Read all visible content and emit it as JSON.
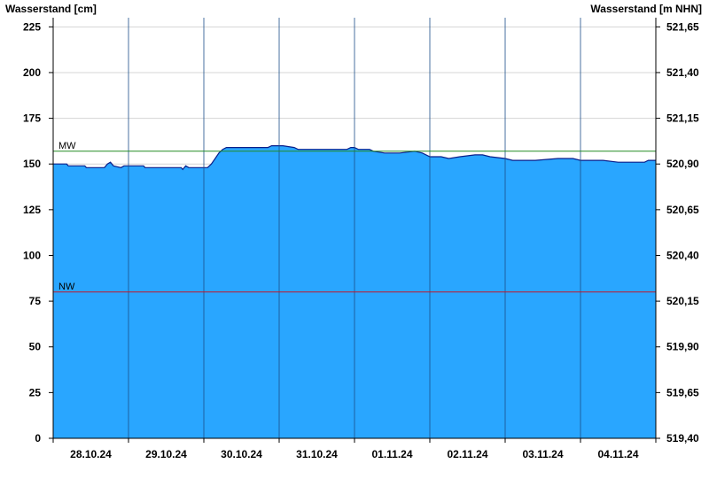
{
  "chart_data": {
    "type": "area",
    "ylabel_left": "Wasserstand [cm]",
    "ylabel_right": "Wasserstand [m NHN]",
    "ylim": [
      0,
      230
    ],
    "yticks_left": [
      0,
      25,
      50,
      75,
      100,
      125,
      150,
      175,
      200,
      225
    ],
    "yticks_right": [
      "519,40",
      "519,65",
      "519,90",
      "520,15",
      "520,40",
      "520,65",
      "520,90",
      "521,15",
      "521,40",
      "521,65"
    ],
    "xlim": [
      0,
      8
    ],
    "x_categories": [
      "28.10.24",
      "29.10.24",
      "30.10.24",
      "31.10.24",
      "01.11.24",
      "02.11.24",
      "03.11.24",
      "04.11.24"
    ],
    "grid": true,
    "colors": {
      "fill": "#29a6ff",
      "line": "#0a1f8a",
      "mw": "#228b22",
      "nw": "#c0182a"
    },
    "reference_lines": [
      {
        "label": "MW",
        "value": 157
      },
      {
        "label": "NW",
        "value": 80
      }
    ],
    "series": [
      {
        "x": [
          0,
          0.18,
          0.2,
          0.42,
          0.44,
          0.68,
          0.72,
          0.76,
          0.8,
          0.9,
          0.94,
          1.2,
          1.22,
          1.5,
          1.7,
          1.72,
          1.74,
          1.76,
          1.8,
          2.05,
          2.1,
          2.15,
          2.2,
          2.25,
          2.3,
          2.4,
          2.55,
          2.85,
          2.9,
          3.05,
          3.2,
          3.25,
          3.5,
          3.9,
          3.95,
          4.0,
          4.05,
          4.2,
          4.25,
          4.4,
          4.5,
          4.6,
          4.8,
          4.9,
          5.0,
          5.15,
          5.25,
          5.4,
          5.6,
          5.7,
          5.8,
          6.0,
          6.1,
          6.3,
          6.4,
          6.7,
          6.9,
          7.0,
          7.3,
          7.5,
          7.7,
          7.85,
          7.9,
          8.0
        ],
        "y": [
          150,
          150,
          149,
          149,
          148,
          148,
          150,
          151,
          149,
          148,
          149,
          149,
          148,
          148,
          148,
          147,
          148,
          149,
          148,
          148,
          150,
          153,
          156,
          158,
          159,
          159,
          159,
          159,
          160,
          160,
          159,
          158,
          158,
          158,
          159,
          159,
          158,
          158,
          157,
          156,
          156,
          156,
          157,
          156,
          154,
          154,
          153,
          154,
          155,
          155,
          154,
          153,
          152,
          152,
          152,
          153,
          153,
          152,
          152,
          151,
          151,
          151,
          152,
          152
        ]
      }
    ]
  }
}
